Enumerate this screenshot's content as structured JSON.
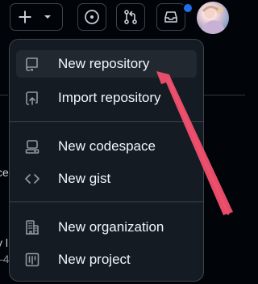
{
  "header": {
    "create_icon": "plus-icon",
    "create_caret_icon": "triangle-down-icon",
    "issues_icon": "issue-opened-icon",
    "pull_requests_icon": "git-pull-request-icon",
    "inbox_icon": "inbox-icon",
    "unread_indicator_color": "#1f6feb"
  },
  "background": {
    "fragment_1": "ce",
    "fragment_2": "y l",
    "fragment_3": "–4"
  },
  "menu": {
    "items": [
      {
        "label": "New repository",
        "icon": "repo-icon",
        "highlighted": true
      },
      {
        "label": "Import repository",
        "icon": "repo-push-icon"
      },
      {
        "label": "New codespace",
        "icon": "codespaces-icon"
      },
      {
        "label": "New gist",
        "icon": "code-icon"
      },
      {
        "label": "New organization",
        "icon": "organization-icon"
      },
      {
        "label": "New project",
        "icon": "project-icon"
      }
    ]
  },
  "annotation": {
    "color": "#f0506e"
  }
}
